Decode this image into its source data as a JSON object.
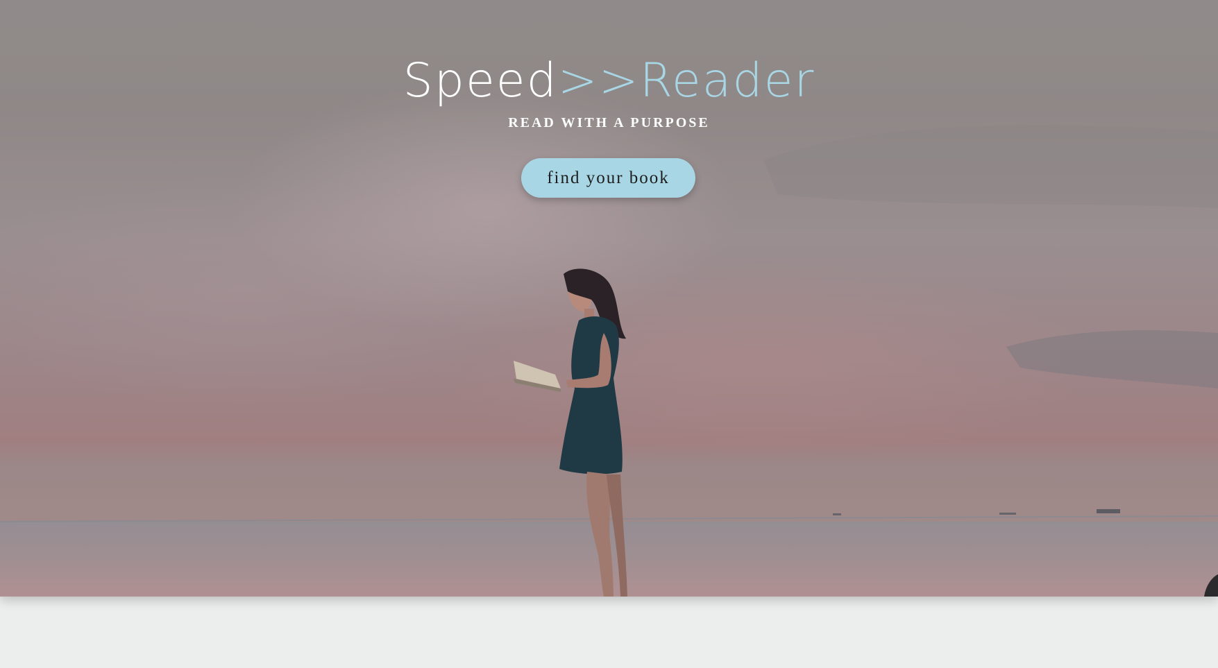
{
  "hero": {
    "brand_part1": "Speed",
    "brand_part2": ">>Reader",
    "tagline": "READ WITH A PURPOSE",
    "cta_label": "find your book",
    "image_alt": "woman-reading-book-by-sea"
  },
  "colors": {
    "accent": "#a9d6e5",
    "text": "#ffffff",
    "button_text": "#1c1c1c",
    "page_background": "#ebeeed"
  }
}
